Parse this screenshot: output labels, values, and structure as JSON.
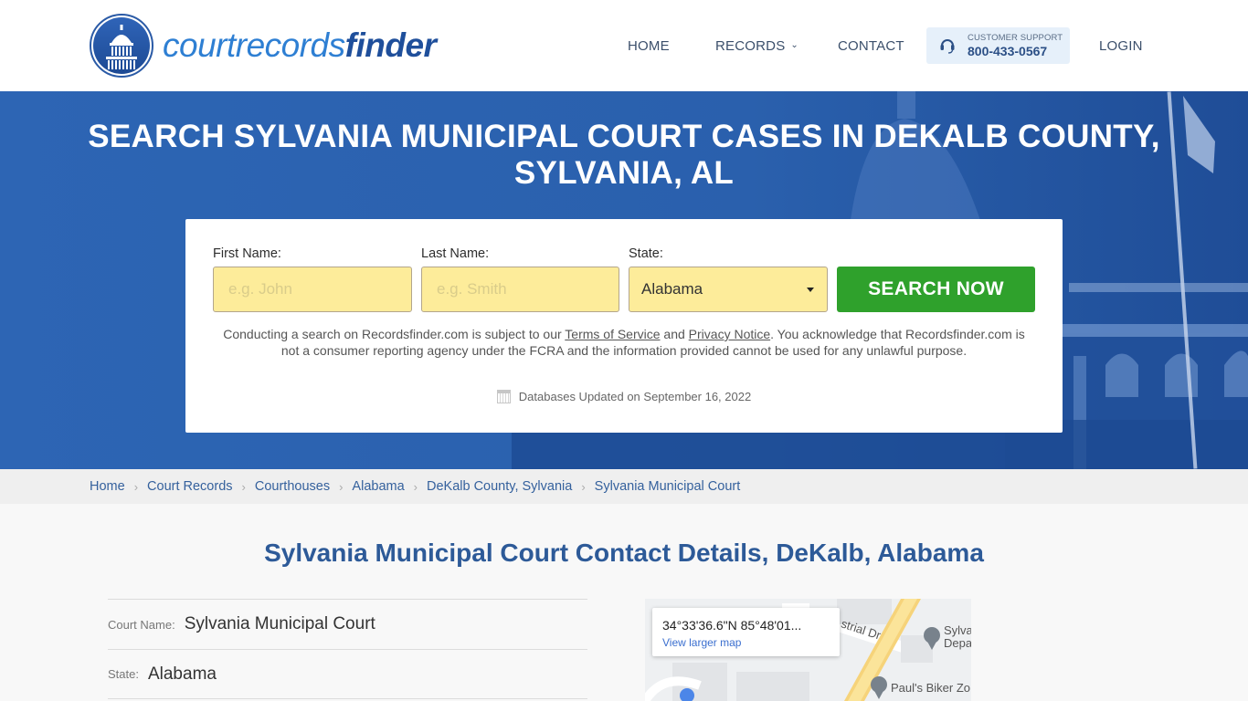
{
  "header": {
    "logo": {
      "part1": "courtrecords",
      "part2": "finder"
    },
    "nav": {
      "home": "HOME",
      "records": "RECORDS",
      "contact": "CONTACT",
      "login": "LOGIN"
    },
    "support": {
      "label": "CUSTOMER SUPPORT",
      "phone": "800-433-0567"
    }
  },
  "hero": {
    "title_line1": "SEARCH SYLVANIA MUNICIPAL COURT CASES IN DEKALB COUNTY,",
    "title_line2": "SYLVANIA, AL"
  },
  "search": {
    "first_name": {
      "label": "First Name:",
      "placeholder": "e.g. John",
      "value": ""
    },
    "last_name": {
      "label": "Last Name:",
      "placeholder": "e.g. Smith",
      "value": ""
    },
    "state": {
      "label": "State:",
      "selected": "Alabama"
    },
    "button": "SEARCH NOW",
    "disclaimer": {
      "part1": "Conducting a search on Recordsfinder.com is subject to our ",
      "terms_link": "Terms of Service",
      "part2": " and ",
      "privacy_link": "Privacy Notice",
      "part3": ". You acknowledge that Recordsfinder.com is not a consumer reporting agency under the FCRA and the information provided cannot be used for any unlawful purpose."
    },
    "db_updated": "Databases Updated on September 16, 2022"
  },
  "breadcrumb": [
    "Home",
    "Court Records",
    "Courthouses",
    "Alabama",
    "DeKalb County, Sylvania",
    "Sylvania Municipal Court"
  ],
  "main": {
    "heading": "Sylvania Municipal Court Contact Details, DeKalb, Alabama",
    "details": [
      {
        "key": "Court Name:",
        "value": "Sylvania Municipal Court"
      },
      {
        "key": "State:",
        "value": "Alabama"
      }
    ]
  },
  "map": {
    "coords": "34°33'36.6\"N 85°48'01...",
    "link": "View larger map",
    "labels": {
      "street": "strial Dr",
      "poi1_line1": "Sylva",
      "poi1_line2": "Depa",
      "poi2": "Paul's Biker Zo"
    }
  },
  "colors": {
    "brand_blue": "#1f4f9b",
    "hero_blue": "#2a61af",
    "search_green": "#2fa12c",
    "input_yellow": "#fdec9a"
  }
}
